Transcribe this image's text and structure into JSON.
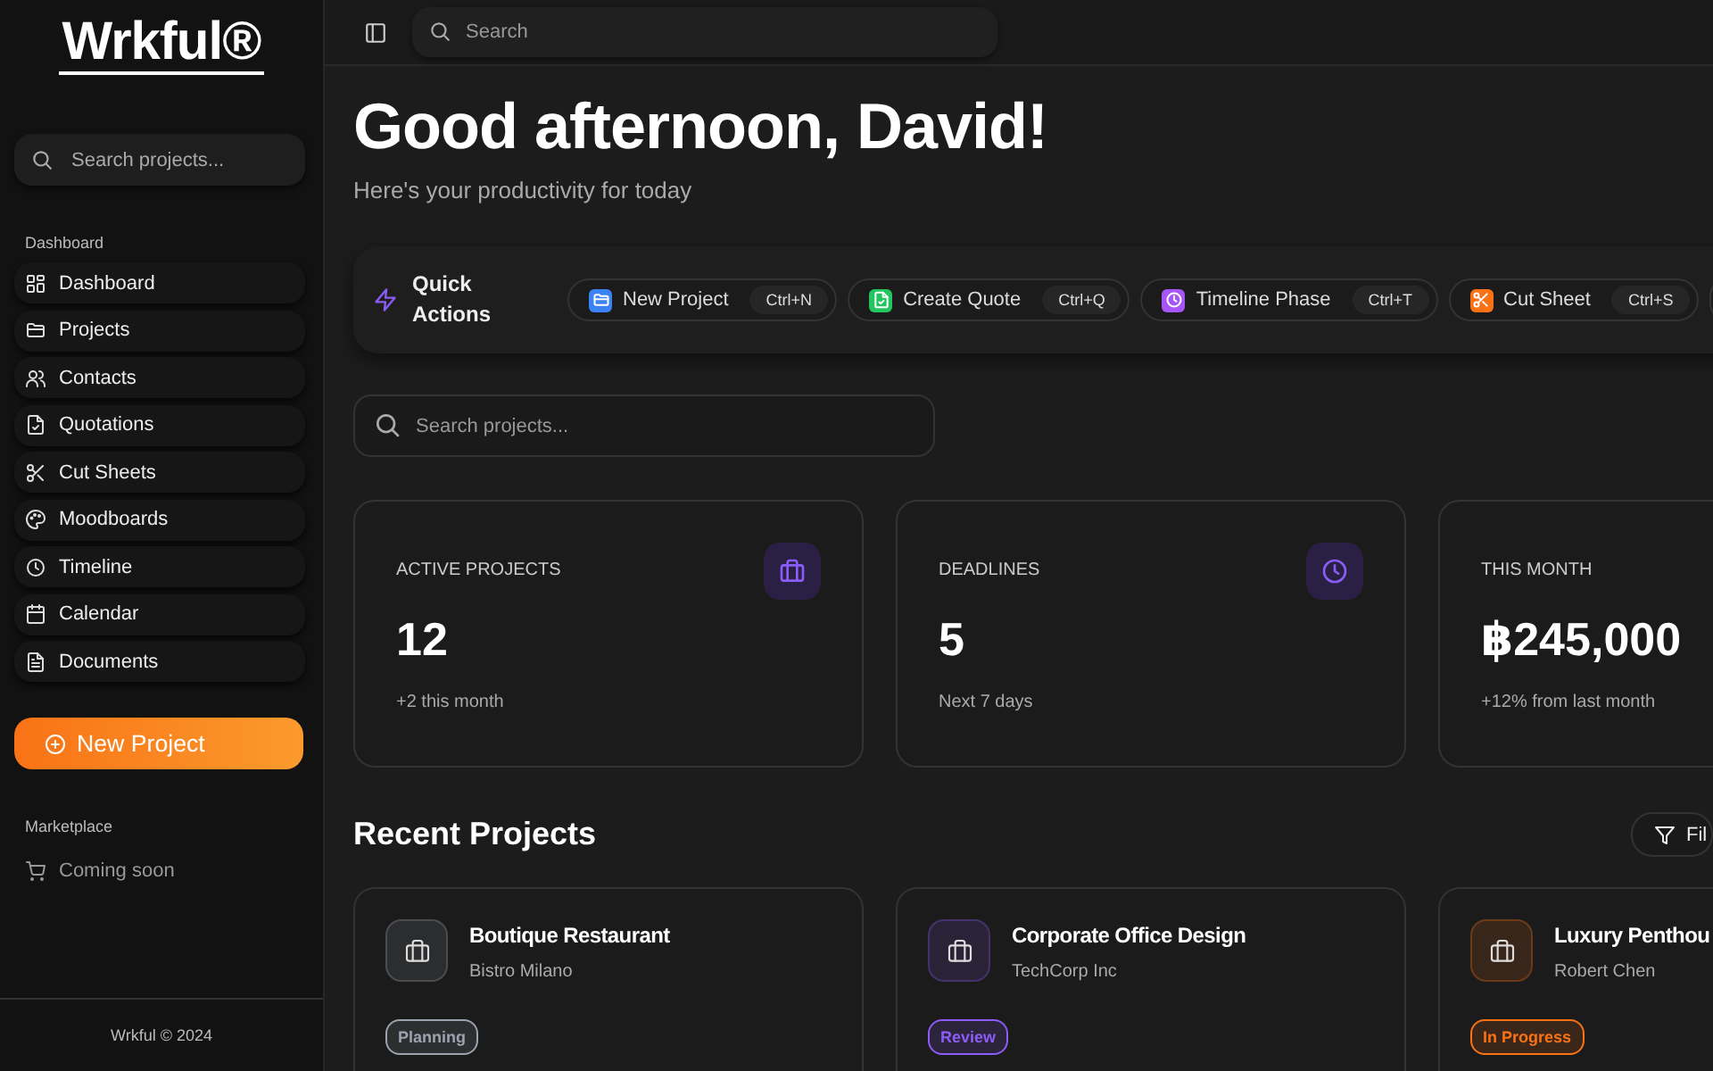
{
  "sidebar": {
    "logo": "Wrkful®",
    "search": {
      "placeholder": "Search projects..."
    },
    "section_label": "Dashboard",
    "items": [
      {
        "label": "Dashboard"
      },
      {
        "label": "Projects"
      },
      {
        "label": "Contacts"
      },
      {
        "label": "Quotations"
      },
      {
        "label": "Cut Sheets"
      },
      {
        "label": "Moodboards"
      },
      {
        "label": "Timeline"
      },
      {
        "label": "Calendar"
      },
      {
        "label": "Documents"
      }
    ],
    "new_project_button": "New Project",
    "marketplace_label": "Marketplace",
    "marketplace_item": "Coming soon",
    "footer": "Wrkful © 2024"
  },
  "topbar": {
    "search": {
      "placeholder": "Search"
    }
  },
  "greeting": "Good afternoon, David!",
  "subtitle": "Here's your productivity for today",
  "quick_actions": {
    "title": "Quick Actions",
    "actions": [
      {
        "label": "New Project",
        "shortcut": "Ctrl+N",
        "color": "#3b82f6"
      },
      {
        "label": "Create Quote",
        "shortcut": "Ctrl+Q",
        "color": "#22c55e"
      },
      {
        "label": "Timeline Phase",
        "shortcut": "Ctrl+T",
        "color": "#a855f7"
      },
      {
        "label": "Cut Sheet",
        "shortcut": "Ctrl+S",
        "color": "#f97316"
      }
    ]
  },
  "project_search": {
    "placeholder": "Search projects..."
  },
  "stats": [
    {
      "label": "ACTIVE PROJECTS",
      "value": "12",
      "note": "+2 this month"
    },
    {
      "label": "DEADLINES",
      "value": "5",
      "note": "Next 7 days"
    },
    {
      "label": "THIS MONTH",
      "value": "฿245,000",
      "note": "+12% from last month"
    }
  ],
  "recent_projects": {
    "title": "Recent Projects",
    "filter_button": "Fil",
    "projects": [
      {
        "name": "Boutique Restaurant",
        "client": "Bistro Milano",
        "status": "Planning",
        "color": "#9ca3af"
      },
      {
        "name": "Corporate Office Design",
        "client": "TechCorp Inc",
        "status": "Review",
        "color": "#8b5cf6"
      },
      {
        "name": "Luxury Penthou",
        "client": "Robert Chen",
        "status": "In Progress",
        "color": "#f97316"
      }
    ]
  }
}
